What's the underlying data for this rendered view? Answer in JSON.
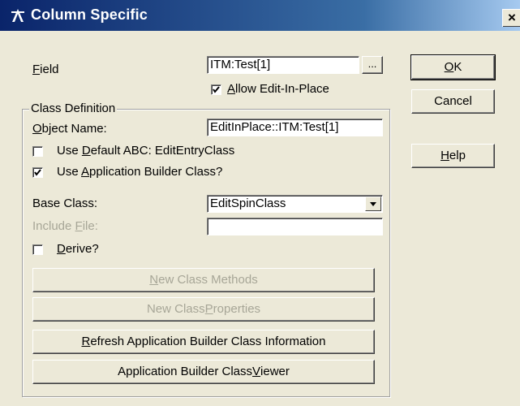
{
  "window": {
    "title": "Column Specific",
    "close_glyph": "×"
  },
  "field": {
    "label_pre": "",
    "label_u": "F",
    "label_post": "ield",
    "value": "ITM:Test[1]",
    "browse_label": "..."
  },
  "allow_edit": {
    "checked": true,
    "label_pre": "",
    "label_u": "A",
    "label_post": "llow Edit-In-Place"
  },
  "class_def": {
    "group_label": "Class Definition",
    "object_name": {
      "label_pre": "",
      "label_u": "O",
      "label_post": "bject Name:",
      "value": "EditInPlace::ITM:Test[1]"
    },
    "use_default": {
      "checked": false,
      "label_pre": "Use ",
      "label_u": "D",
      "label_post": "efault ABC: EditEntryClass"
    },
    "use_app_builder": {
      "checked": true,
      "label_pre": "Use ",
      "label_u": "A",
      "label_post": "pplication Builder Class?"
    },
    "base_class": {
      "label": "Base Class:",
      "value": "EditSpinClass"
    },
    "include_file": {
      "label_pre": "Include ",
      "label_u": "F",
      "label_post": "ile:",
      "value": ""
    },
    "derive": {
      "checked": false,
      "label_pre": "",
      "label_u": "D",
      "label_post": "erive?"
    },
    "buttons": {
      "new_methods": {
        "pre": "",
        "u": "N",
        "post": "ew Class Methods"
      },
      "new_properties": {
        "pre": "New Class ",
        "u": "P",
        "post": "roperties"
      },
      "refresh": {
        "pre": "",
        "u": "R",
        "post": "efresh Application Builder Class Information"
      },
      "viewer": {
        "pre": "Application Builder Class ",
        "u": "V",
        "post": "iewer"
      }
    }
  },
  "actions": {
    "ok": {
      "pre": "",
      "u": "O",
      "post": "K"
    },
    "cancel": {
      "label": "Cancel"
    },
    "help": {
      "pre": "",
      "u": "H",
      "post": "elp"
    }
  }
}
